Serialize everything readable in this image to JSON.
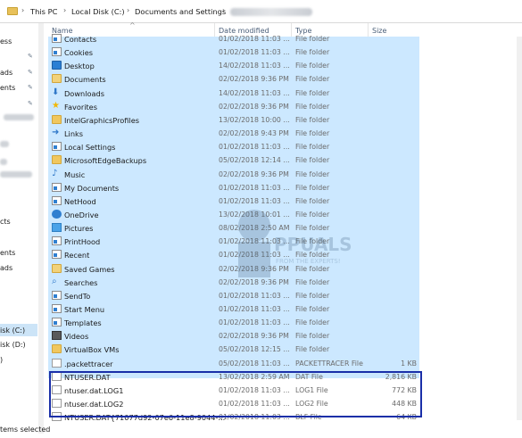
{
  "breadcrumb": [
    "This PC",
    "Local Disk (C:)",
    "Documents and Settings"
  ],
  "nav": {
    "items": [
      {
        "label": "ess"
      },
      {
        "label": "ads"
      },
      {
        "label": "ents"
      },
      {
        "label": "cts"
      },
      {
        "label": "ents"
      },
      {
        "label": "ads"
      },
      {
        "label": "isk (C:)"
      },
      {
        "label": "isk (D:)"
      },
      {
        "label": ")"
      }
    ]
  },
  "status": "tems selected",
  "columns": {
    "name": "Name",
    "date": "Date modified",
    "type": "Type",
    "size": "Size"
  },
  "files": [
    {
      "icon": "link-folder-icon",
      "name": "Contacts",
      "date": "01/02/2018 11:03 ...",
      "type": "File folder",
      "size": ""
    },
    {
      "icon": "link-folder-icon",
      "name": "Cookies",
      "date": "01/02/2018 11:03 ...",
      "type": "File folder",
      "size": ""
    },
    {
      "icon": "desktop-icon",
      "name": "Desktop",
      "date": "14/02/2018 11:03 ...",
      "type": "File folder",
      "size": ""
    },
    {
      "icon": "documents-icon",
      "name": "Documents",
      "date": "02/02/2018 9:36 PM",
      "type": "File folder",
      "size": ""
    },
    {
      "icon": "downloads-icon",
      "name": "Downloads",
      "date": "14/02/2018 11:03 ...",
      "type": "File folder",
      "size": ""
    },
    {
      "icon": "favorites-icon",
      "name": "Favorites",
      "date": "02/02/2018 9:36 PM",
      "type": "File folder",
      "size": ""
    },
    {
      "icon": "folder-icon",
      "name": "IntelGraphicsProfiles",
      "date": "13/02/2018 10:00 ...",
      "type": "File folder",
      "size": ""
    },
    {
      "icon": "links-icon",
      "name": "Links",
      "date": "02/02/2018 9:43 PM",
      "type": "File folder",
      "size": ""
    },
    {
      "icon": "link-folder-icon",
      "name": "Local Settings",
      "date": "01/02/2018 11:03 ...",
      "type": "File folder",
      "size": ""
    },
    {
      "icon": "folder-icon",
      "name": "MicrosoftEdgeBackups",
      "date": "05/02/2018 12:14 ...",
      "type": "File folder",
      "size": ""
    },
    {
      "icon": "music-icon",
      "name": "Music",
      "date": "02/02/2018 9:36 PM",
      "type": "File folder",
      "size": ""
    },
    {
      "icon": "link-folder-icon",
      "name": "My Documents",
      "date": "01/02/2018 11:03 ...",
      "type": "File folder",
      "size": ""
    },
    {
      "icon": "link-folder-icon",
      "name": "NetHood",
      "date": "01/02/2018 11:03 ...",
      "type": "File folder",
      "size": ""
    },
    {
      "icon": "onedrive-icon",
      "name": "OneDrive",
      "date": "13/02/2018 10:01 ...",
      "type": "File folder",
      "size": ""
    },
    {
      "icon": "pictures-icon",
      "name": "Pictures",
      "date": "08/02/2018 2:50 AM",
      "type": "File folder",
      "size": ""
    },
    {
      "icon": "link-folder-icon",
      "name": "PrintHood",
      "date": "01/02/2018 11:03 ...",
      "type": "File folder",
      "size": ""
    },
    {
      "icon": "link-folder-icon",
      "name": "Recent",
      "date": "01/02/2018 11:03 ...",
      "type": "File folder",
      "size": ""
    },
    {
      "icon": "saved-games-icon",
      "name": "Saved Games",
      "date": "02/02/2018 9:36 PM",
      "type": "File folder",
      "size": ""
    },
    {
      "icon": "searches-icon",
      "name": "Searches",
      "date": "02/02/2018 9:36 PM",
      "type": "File folder",
      "size": ""
    },
    {
      "icon": "link-folder-icon",
      "name": "SendTo",
      "date": "01/02/2018 11:03 ...",
      "type": "File folder",
      "size": ""
    },
    {
      "icon": "link-folder-icon",
      "name": "Start Menu",
      "date": "01/02/2018 11:03 ...",
      "type": "File folder",
      "size": ""
    },
    {
      "icon": "link-folder-icon",
      "name": "Templates",
      "date": "01/02/2018 11:03 ...",
      "type": "File folder",
      "size": ""
    },
    {
      "icon": "videos-icon",
      "name": "Videos",
      "date": "02/02/2018 9:36 PM",
      "type": "File folder",
      "size": ""
    },
    {
      "icon": "folder-icon",
      "name": "VirtualBox VMs",
      "date": "05/02/2018 12:15 ...",
      "type": "File folder",
      "size": ""
    },
    {
      "icon": "file-icon",
      "name": ".packettracer",
      "date": "05/02/2018 11:03 ...",
      "type": "PACKETTRACER File",
      "size": "1 KB"
    },
    {
      "icon": "file-icon",
      "name": "NTUSER.DAT",
      "date": "13/02/2018 2:59 AM",
      "type": "DAT File",
      "size": "2,816 KB"
    },
    {
      "icon": "file-icon",
      "name": "ntuser.dat.LOG1",
      "date": "01/02/2018 11:03 ...",
      "type": "LOG1 File",
      "size": "772 KB"
    },
    {
      "icon": "file-icon",
      "name": "ntuser.dat.LOG2",
      "date": "01/02/2018 11:03 ...",
      "type": "LOG2 File",
      "size": "448 KB"
    },
    {
      "icon": "file-icon",
      "name": "NTUSER.DAT{71077d92-07e6-11e8-9044-...",
      "date": "01/02/2018 11:03 ...",
      "type": "BLF File",
      "size": "64 KB"
    }
  ],
  "watermark": {
    "text1": "PPUALS",
    "text2": "FROM THE EXPERTS!"
  }
}
